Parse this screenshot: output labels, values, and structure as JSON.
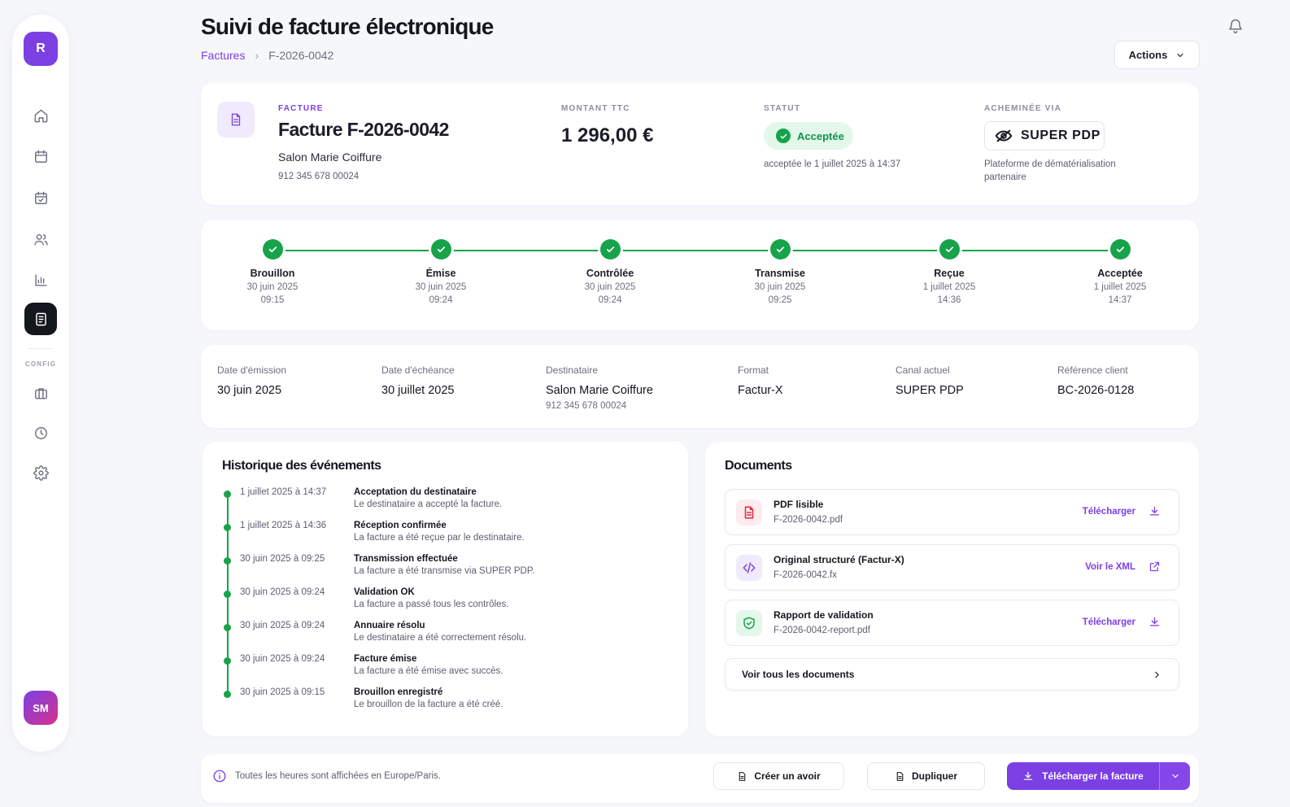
{
  "sidebar": {
    "logo": "R",
    "section_label": "CONFIG",
    "avatar": "SM",
    "items": [
      {
        "icon": "home-icon"
      },
      {
        "icon": "calendar-icon"
      },
      {
        "icon": "calendar-check-icon"
      },
      {
        "icon": "users-icon"
      },
      {
        "icon": "bar-chart-icon"
      },
      {
        "icon": "invoice-icon",
        "active": true
      },
      {
        "icon": "briefcase-icon"
      },
      {
        "icon": "clock-icon"
      },
      {
        "icon": "gear-icon"
      }
    ]
  },
  "header": {
    "title": "Suivi de facture électronique",
    "breadcrumb": {
      "parent": "Factures",
      "separator": "›",
      "current": "F-2026-0042"
    },
    "actions_label": "Actions"
  },
  "summary": {
    "invoice_kicker": "FACTURE",
    "invoice_title": "Facture F-2026-0042",
    "client": "Salon Marie Coiffure",
    "siret": "912 345 678 00024",
    "amount_kicker": "MONTANT TTC",
    "amount": "1 296,00 €",
    "status_kicker": "STATUT",
    "status": "Acceptée",
    "status_date": "acceptée le 1 juillet 2025 à 14:37",
    "routed_kicker": "ACHEMINÉE VIA",
    "pdp_name": "SUPER PDP",
    "pdp_description": "Plateforme de dématérialisation partenaire"
  },
  "timeline": [
    {
      "label": "Brouillon",
      "date": "30 juin 2025",
      "time": "09:15"
    },
    {
      "label": "Émise",
      "date": "30 juin 2025",
      "time": "09:24"
    },
    {
      "label": "Contrôlée",
      "date": "30 juin 2025",
      "time": "09:24"
    },
    {
      "label": "Transmise",
      "date": "30 juin 2025",
      "time": "09:25"
    },
    {
      "label": "Reçue",
      "date": "1 juillet 2025",
      "time": "14:36"
    },
    {
      "label": "Acceptée",
      "date": "1 juillet 2025",
      "time": "14:37"
    }
  ],
  "details": [
    {
      "key": "Date d'émission",
      "value": "30 juin 2025",
      "sub": ""
    },
    {
      "key": "Date d'échéance",
      "value": "30 juillet 2025",
      "sub": ""
    },
    {
      "key": "Destinataire",
      "value": "Salon Marie Coiffure",
      "sub": "912 345 678 00024"
    },
    {
      "key": "Format",
      "value": "Factur-X",
      "sub": ""
    },
    {
      "key": "Canal actuel",
      "value": "SUPER PDP",
      "sub": ""
    },
    {
      "key": "Référence client",
      "value": "BC-2026-0128",
      "sub": ""
    }
  ],
  "history": {
    "title": "Historique des événements",
    "events": [
      {
        "time": "1 juillet 2025 à 14:37",
        "title": "Acceptation du destinataire",
        "desc": "Le destinataire a accepté la facture."
      },
      {
        "time": "1 juillet 2025 à 14:36",
        "title": "Réception confirmée",
        "desc": "La facture a été reçue par le destinataire."
      },
      {
        "time": "30 juin 2025 à 09:25",
        "title": "Transmission effectuée",
        "desc": "La facture a été transmise via SUPER PDP."
      },
      {
        "time": "30 juin 2025 à 09:24",
        "title": "Validation OK",
        "desc": "La facture a passé tous les contrôles."
      },
      {
        "time": "30 juin 2025 à 09:24",
        "title": "Annuaire résolu",
        "desc": "Le destinataire a été correctement résolu."
      },
      {
        "time": "30 juin 2025 à 09:24",
        "title": "Facture émise",
        "desc": "La facture a été émise avec succès."
      },
      {
        "time": "30 juin 2025 à 09:15",
        "title": "Brouillon enregistré",
        "desc": "Le brouillon de la facture a été créé."
      }
    ]
  },
  "documents": {
    "title": "Documents",
    "items": [
      {
        "name": "PDF lisible",
        "file": "F-2026-0042.pdf",
        "action": "Télécharger",
        "icon": "pdf-icon",
        "action_icon": "download-icon",
        "color": "#e0243a",
        "bg": "#fdebee"
      },
      {
        "name": "Original structuré (Factur-X)",
        "file": "F-2026-0042.fx",
        "action": "Voir le XML",
        "icon": "code-icon",
        "action_icon": "external-link-icon",
        "color": "#7b3fe4",
        "bg": "#f0ebfc"
      },
      {
        "name": "Rapport de validation",
        "file": "F-2026-0042-report.pdf",
        "action": "Télécharger",
        "icon": "shield-check-icon",
        "action_icon": "download-icon",
        "color": "#16a34a",
        "bg": "#e3f7ea"
      }
    ],
    "view_all": "Voir tous les documents"
  },
  "footer": {
    "timezone_note": "Toutes les heures sont affichées en Europe/Paris.",
    "credit_note_btn": "Créer un avoir",
    "duplicate_btn": "Dupliquer",
    "download_btn": "Télécharger la facture"
  },
  "colors": {
    "accent": "#7b3fe4",
    "success": "#16a34a",
    "background": "#f6f7fa"
  }
}
